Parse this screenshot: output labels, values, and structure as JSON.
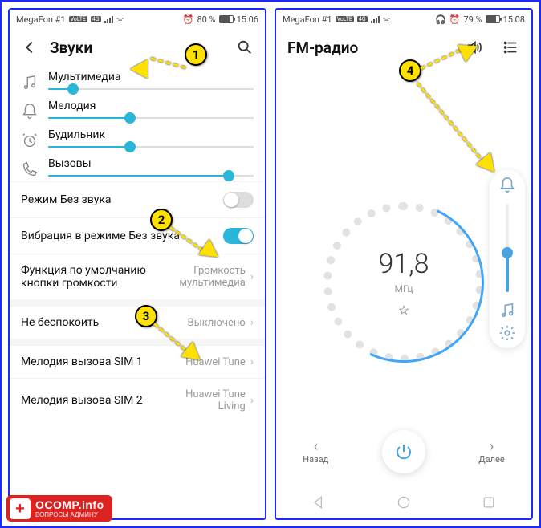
{
  "left": {
    "statusbar": {
      "carrier": "MegaFon #1",
      "battery_pct": "80 %",
      "time": "15:06"
    },
    "header": {
      "title": "Звуки"
    },
    "sliders": [
      {
        "label": "Мультимедиа",
        "pct": 12
      },
      {
        "label": "Мелодия",
        "pct": 40
      },
      {
        "label": "Будильник",
        "pct": 40
      },
      {
        "label": "Вызовы",
        "pct": 88
      }
    ],
    "rows": {
      "silent": {
        "label": "Режим Без звука",
        "on": false
      },
      "vibrate": {
        "label": "Вибрация в режиме Без звука",
        "on": true
      },
      "volkey": {
        "label": "Функция по умолчанию кнопки громкости",
        "value": "Громкость мультимедиа"
      },
      "dnd": {
        "label": "Не беспокоить",
        "value": "Выключено"
      },
      "sim1": {
        "label": "Мелодия вызова SIM 1",
        "value": "Huawei Tune"
      },
      "sim2": {
        "label": "Мелодия вызова SIM 2",
        "value": "Huawei Tune Living"
      }
    }
  },
  "right": {
    "statusbar": {
      "carrier": "MegaFon #1",
      "battery_pct": "79 %",
      "time": "15:08"
    },
    "header": {
      "title": "FM-радио"
    },
    "freq": {
      "value": "91,8",
      "unit": "МГц"
    },
    "controls": {
      "prev": "Назад",
      "next": "Далее"
    },
    "volume_pct": 45
  },
  "badges": {
    "b1": "1",
    "b2": "2",
    "b3": "3",
    "b4": "4"
  },
  "watermark": {
    "big": "OCOMP.info",
    "small": "ВОПРОСЫ АДМИНУ"
  }
}
